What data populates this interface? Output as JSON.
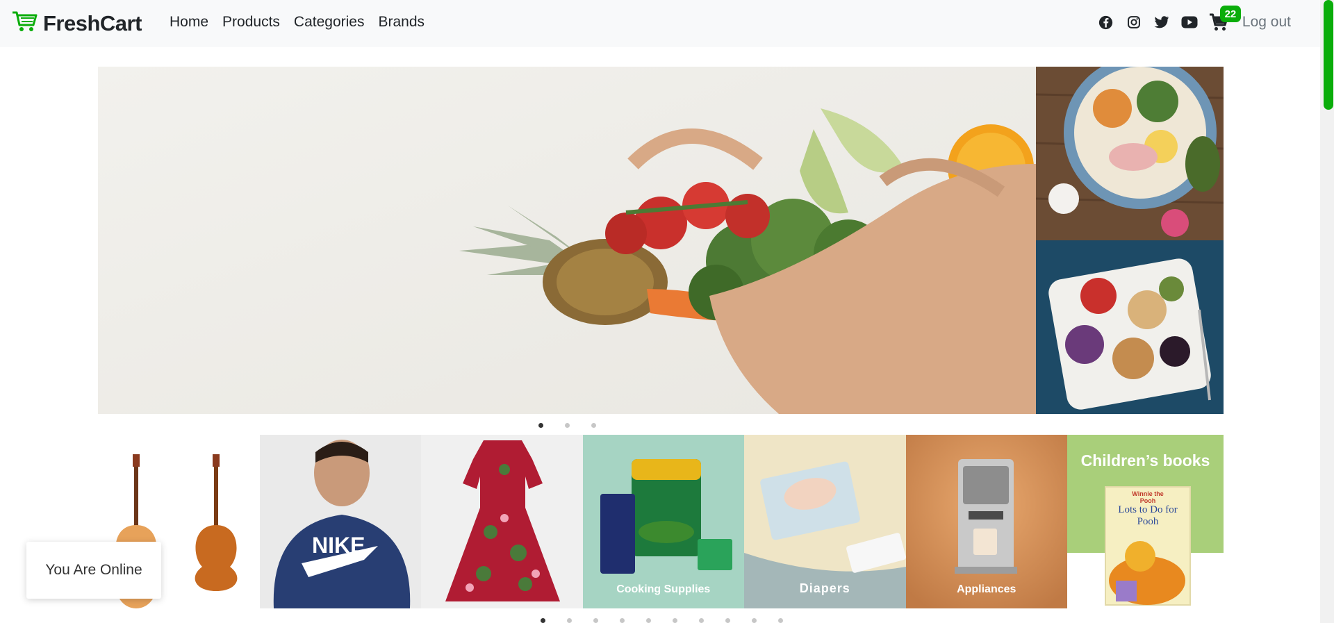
{
  "brand": {
    "name": "FreshCart",
    "accent_color": "#0aad0a"
  },
  "nav": {
    "links": [
      "Home",
      "Products",
      "Categories",
      "Brands"
    ],
    "social_icons": [
      "facebook-icon",
      "instagram-icon",
      "twitter-icon",
      "youtube-icon"
    ],
    "cart_count": "22",
    "logout_label": "Log out"
  },
  "hero": {
    "slide_count": 3,
    "active_slide": 1
  },
  "categories": {
    "items": [
      {
        "name": "guitars",
        "label": ""
      },
      {
        "name": "mens-fashion",
        "label": ""
      },
      {
        "name": "womens-fashion",
        "label": ""
      },
      {
        "name": "cooking-supplies",
        "label": "Cooking Supplies"
      },
      {
        "name": "diapers",
        "label": "Diapers"
      },
      {
        "name": "appliances",
        "label": "Appliances"
      },
      {
        "name": "childrens-books",
        "label": "Children’s books"
      }
    ],
    "book_cover": {
      "brand": "Winnie the Pooh",
      "title": "Lots to Do for Pooh"
    },
    "dot_count": 10,
    "active_dot": 1
  },
  "toast": {
    "message": "You Are Online"
  }
}
